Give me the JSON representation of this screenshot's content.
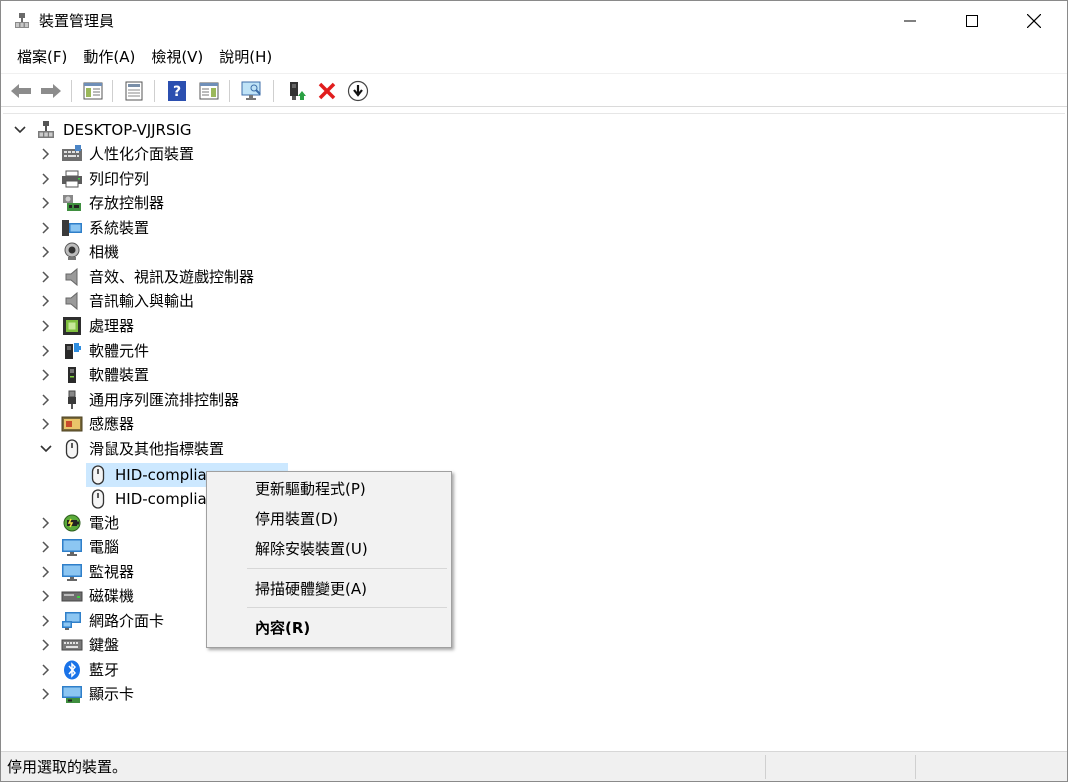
{
  "window": {
    "title": "裝置管理員"
  },
  "menu": [
    "檔案(F)",
    "動作(A)",
    "檢視(V)",
    "說明(H)"
  ],
  "tree": {
    "root": "DESKTOP-VJJRSIG",
    "categories": [
      {
        "label": "人性化介面裝置",
        "icon": "hid-icon"
      },
      {
        "label": "列印佇列",
        "icon": "printer-icon"
      },
      {
        "label": "存放控制器",
        "icon": "storage-controller-icon"
      },
      {
        "label": "系統裝置",
        "icon": "system-devices-icon"
      },
      {
        "label": "相機",
        "icon": "camera-icon"
      },
      {
        "label": "音效、視訊及遊戲控制器",
        "icon": "speaker-icon"
      },
      {
        "label": "音訊輸入與輸出",
        "icon": "speaker-icon"
      },
      {
        "label": "處理器",
        "icon": "processor-icon"
      },
      {
        "label": "軟體元件",
        "icon": "software-component-icon"
      },
      {
        "label": "軟體裝置",
        "icon": "software-device-icon"
      },
      {
        "label": "通用序列匯流排控制器",
        "icon": "usb-icon"
      },
      {
        "label": "感應器",
        "icon": "sensor-icon"
      },
      {
        "label": "滑鼠及其他指標裝置",
        "icon": "mouse-icon",
        "expanded": true,
        "children": [
          "HID-complia",
          "HID-complia"
        ]
      },
      {
        "label": "電池",
        "icon": "battery-icon"
      },
      {
        "label": "電腦",
        "icon": "computer-icon"
      },
      {
        "label": "監視器",
        "icon": "monitor-icon"
      },
      {
        "label": "磁碟機",
        "icon": "disk-drive-icon"
      },
      {
        "label": "網路介面卡",
        "icon": "network-adapter-icon"
      },
      {
        "label": "鍵盤",
        "icon": "keyboard-icon"
      },
      {
        "label": "藍牙",
        "icon": "bluetooth-icon"
      },
      {
        "label": "顯示卡",
        "icon": "display-adapter-icon"
      }
    ]
  },
  "context_menu": {
    "update_driver": "更新驅動程式(P)",
    "disable_device": "停用裝置(D)",
    "uninstall_device": "解除安裝裝置(U)",
    "scan_hardware": "掃描硬體變更(A)",
    "properties": "內容(R)"
  },
  "status": {
    "text": "停用選取的裝置。"
  },
  "colors": {
    "selection": "#cce8ff",
    "context_bg": "#f2f2f2",
    "status_bg": "#f0f0f0"
  }
}
